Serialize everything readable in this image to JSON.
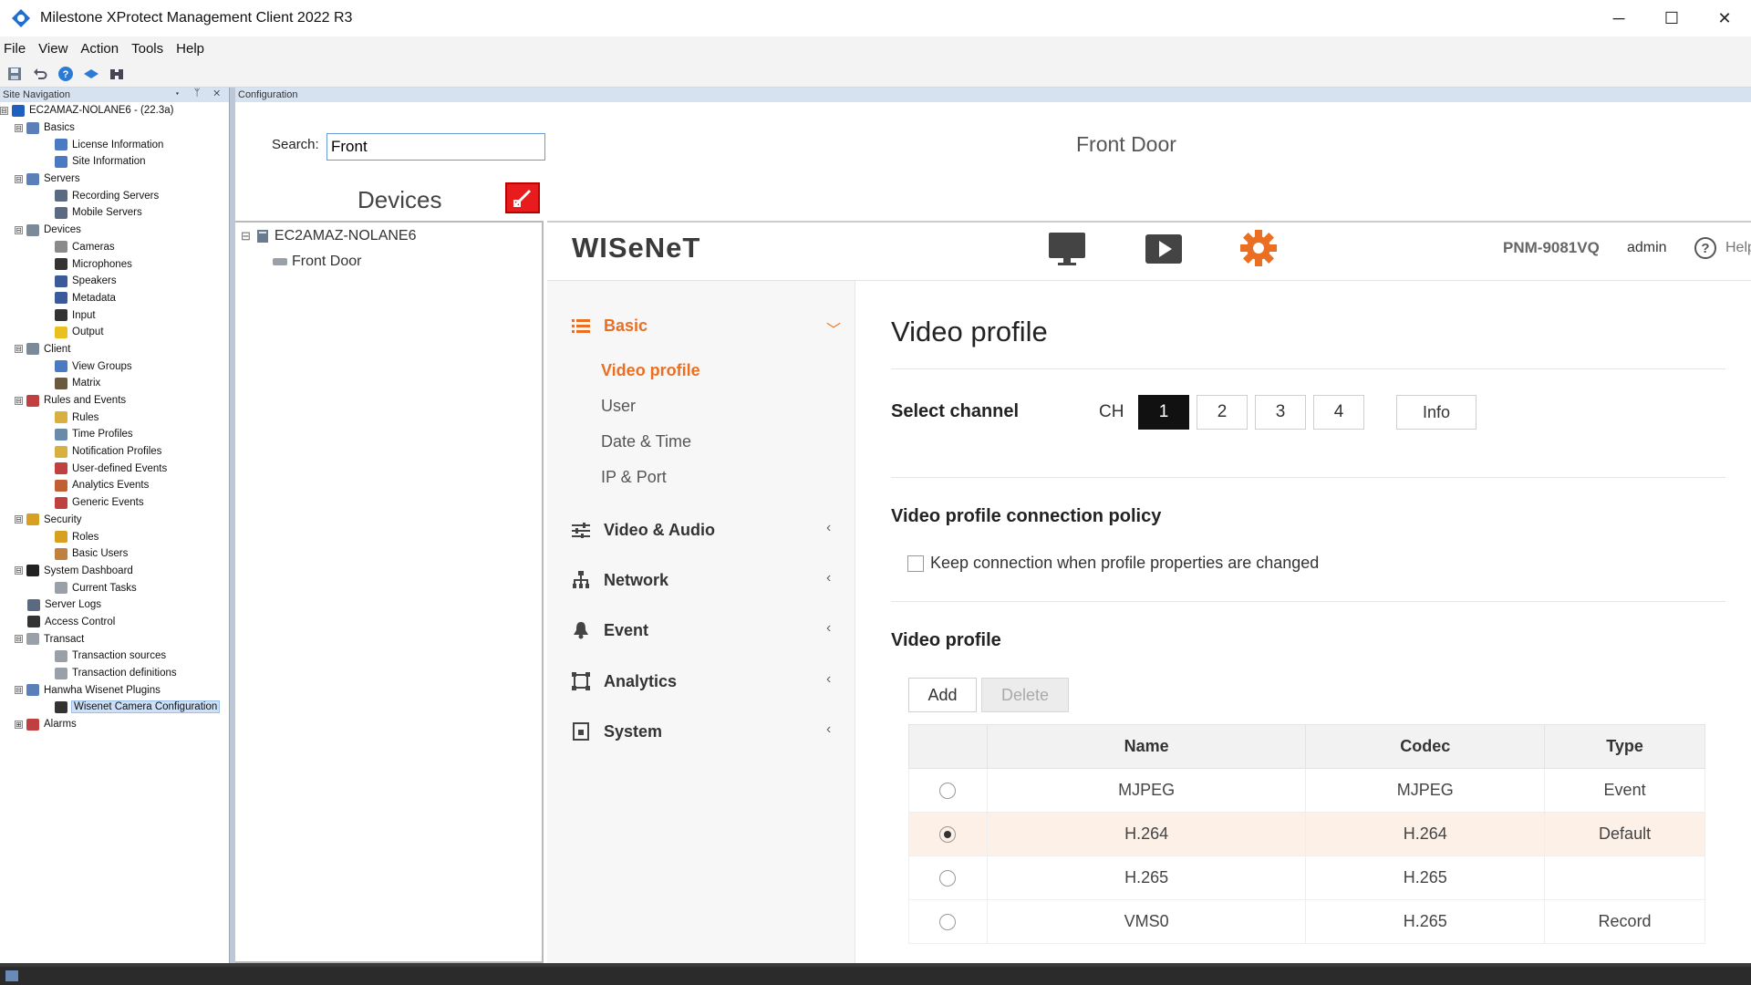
{
  "window": {
    "title": "Milestone XProtect Management Client 2022 R3",
    "minimize": "─",
    "maximize": "☐",
    "close": "✕"
  },
  "menubar": {
    "items": [
      "File",
      "View",
      "Action",
      "Tools",
      "Help"
    ]
  },
  "toolbar": {
    "icons": [
      "save-icon",
      "undo-icon",
      "help-icon",
      "connect-icon",
      "binoculars-icon"
    ]
  },
  "site_navigation": {
    "header": "Site Navigation",
    "controls": "▾ ᛘ ✕",
    "tree": [
      {
        "label": "EC2AMAZ-NOLANE6 - (22.3a)",
        "level": 0,
        "expander": "⊟",
        "icon": "server-site-icon",
        "color": "#1f5fbf"
      },
      {
        "label": "Basics",
        "level": 1,
        "expander": "⊟",
        "icon": "book-icon",
        "color": "#5b7fb8"
      },
      {
        "label": "License Information",
        "level": 2,
        "icon": "license-icon",
        "color": "#4a7ac2"
      },
      {
        "label": "Site Information",
        "level": 2,
        "icon": "info-icon",
        "color": "#4a7ac2"
      },
      {
        "label": "Servers",
        "level": 1,
        "expander": "⊟",
        "icon": "servers-icon",
        "color": "#5b7fb8"
      },
      {
        "label": "Recording Servers",
        "level": 2,
        "icon": "recording-server-icon",
        "color": "#5a6a80"
      },
      {
        "label": "Mobile Servers",
        "level": 2,
        "icon": "mobile-server-icon",
        "color": "#5a6a80"
      },
      {
        "label": "Devices",
        "level": 1,
        "expander": "⊟",
        "icon": "devices-icon",
        "color": "#7a8a99"
      },
      {
        "label": "Cameras",
        "level": 2,
        "icon": "camera-icon",
        "color": "#8a8a8a"
      },
      {
        "label": "Microphones",
        "level": 2,
        "icon": "microphone-icon",
        "color": "#333333"
      },
      {
        "label": "Speakers",
        "level": 2,
        "icon": "speaker-icon",
        "color": "#3a5a9a"
      },
      {
        "label": "Metadata",
        "level": 2,
        "icon": "metadata-icon",
        "color": "#3a5a9a"
      },
      {
        "label": "Input",
        "level": 2,
        "icon": "input-icon",
        "color": "#333333"
      },
      {
        "label": "Output",
        "level": 2,
        "icon": "output-icon",
        "color": "#e8c020"
      },
      {
        "label": "Client",
        "level": 1,
        "expander": "⊟",
        "icon": "client-icon",
        "color": "#7a8a99"
      },
      {
        "label": "View Groups",
        "level": 2,
        "icon": "view-groups-icon",
        "color": "#4a7ac2"
      },
      {
        "label": "Matrix",
        "level": 2,
        "icon": "matrix-icon",
        "color": "#6a5a40"
      },
      {
        "label": "Rules and Events",
        "level": 1,
        "expander": "⊟",
        "icon": "rules-events-icon",
        "color": "#c04040"
      },
      {
        "label": "Rules",
        "level": 2,
        "icon": "rules-icon",
        "color": "#d8b040"
      },
      {
        "label": "Time Profiles",
        "level": 2,
        "icon": "clock-icon",
        "color": "#6a8aaa"
      },
      {
        "label": "Notification Profiles",
        "level": 2,
        "icon": "envelope-icon",
        "color": "#d8b040"
      },
      {
        "label": "User-defined Events",
        "level": 2,
        "icon": "user-event-icon",
        "color": "#c04040"
      },
      {
        "label": "Analytics Events",
        "level": 2,
        "icon": "analytics-event-icon",
        "color": "#c06030"
      },
      {
        "label": "Generic Events",
        "level": 2,
        "icon": "generic-event-icon",
        "color": "#c04040"
      },
      {
        "label": "Security",
        "level": 1,
        "expander": "⊟",
        "icon": "security-icon",
        "color": "#d8a020"
      },
      {
        "label": "Roles",
        "level": 2,
        "icon": "roles-icon",
        "color": "#d8a020"
      },
      {
        "label": "Basic Users",
        "level": 2,
        "icon": "basic-users-icon",
        "color": "#c08040"
      },
      {
        "label": "System Dashboard",
        "level": 1,
        "expander": "⊟",
        "icon": "dashboard-icon",
        "color": "#222222"
      },
      {
        "label": "Current Tasks",
        "level": 2,
        "icon": "tasks-icon",
        "color": "#9aa0a8"
      },
      {
        "label": "Server Logs",
        "level": 1,
        "icon": "server-logs-icon",
        "color": "#5a6a80"
      },
      {
        "label": "Access Control",
        "level": 1,
        "icon": "access-control-icon",
        "color": "#333333"
      },
      {
        "label": "Transact",
        "level": 1,
        "expander": "⊟",
        "icon": "transact-icon",
        "color": "#9aa0a8"
      },
      {
        "label": "Transaction sources",
        "level": 2,
        "icon": "transaction-sources-icon",
        "color": "#9aa0a8"
      },
      {
        "label": "Transaction definitions",
        "level": 2,
        "icon": "transaction-definitions-icon",
        "color": "#9aa0a8"
      },
      {
        "label": "Hanwha Wisenet Plugins",
        "level": 1,
        "expander": "⊟",
        "icon": "plugin-icon",
        "color": "#5b7fb8"
      },
      {
        "label": "Wisenet Camera Configuration",
        "level": 2,
        "icon": "camera-config-icon",
        "color": "#333333",
        "selected": true
      },
      {
        "label": "Alarms",
        "level": 1,
        "expander": "⊞",
        "icon": "alarms-icon",
        "color": "#c04040"
      }
    ]
  },
  "configuration": {
    "header": "Configuration",
    "search_label": "Search:",
    "search_value": "Front",
    "devices_title": "Devices",
    "clear_icon": "clear-filter-icon",
    "device_tree": {
      "root": "EC2AMAZ-NOLANE6",
      "root_expander": "⊟",
      "child": "Front Door"
    },
    "device_name": "Front Door"
  },
  "wisenet": {
    "logo": "WISeNeT",
    "header_icons": [
      "monitor-icon",
      "play-icon",
      "settings-gear-icon"
    ],
    "model": "PNM-9081VQ",
    "user": "admin",
    "help_icon": "?",
    "help_label": "Help",
    "menu": {
      "basic": {
        "label": "Basic",
        "arrow": "﹀",
        "items": [
          "Video profile",
          "User",
          "Date & Time",
          "IP & Port"
        ]
      },
      "video_audio": {
        "label": "Video & Audio",
        "arrow": "‹"
      },
      "network": {
        "label": "Network",
        "arrow": "‹"
      },
      "event": {
        "label": "Event",
        "arrow": "‹"
      },
      "analytics": {
        "label": "Analytics",
        "arrow": "‹"
      },
      "system": {
        "label": "System",
        "arrow": "‹"
      }
    },
    "page_title": "Video profile",
    "select_channel": "Select channel",
    "ch_label": "CH",
    "channels": [
      "1",
      "2",
      "3",
      "4"
    ],
    "active_channel": "1",
    "info_button": "Info",
    "connection_policy_title": "Video profile connection policy",
    "keep_connection_label": "Keep connection when profile properties are changed",
    "keep_connection_checked": false,
    "video_profile_title": "Video profile",
    "add_button": "Add",
    "delete_button": "Delete",
    "table": {
      "headers": [
        "Name",
        "Codec",
        "Type"
      ],
      "rows": [
        {
          "name": "MJPEG",
          "codec": "MJPEG",
          "type": "Event",
          "selected": false
        },
        {
          "name": "H.264",
          "codec": "H.264",
          "type": "Default",
          "selected": true
        },
        {
          "name": "H.265",
          "codec": "H.265",
          "type": "",
          "selected": false
        },
        {
          "name": "VMS0",
          "codec": "H.265",
          "type": "Record",
          "selected": false
        }
      ]
    }
  },
  "colors": {
    "accent": "#ea6f22",
    "selection": "#fdf0e7",
    "panel_header": "#d7e2f0"
  }
}
